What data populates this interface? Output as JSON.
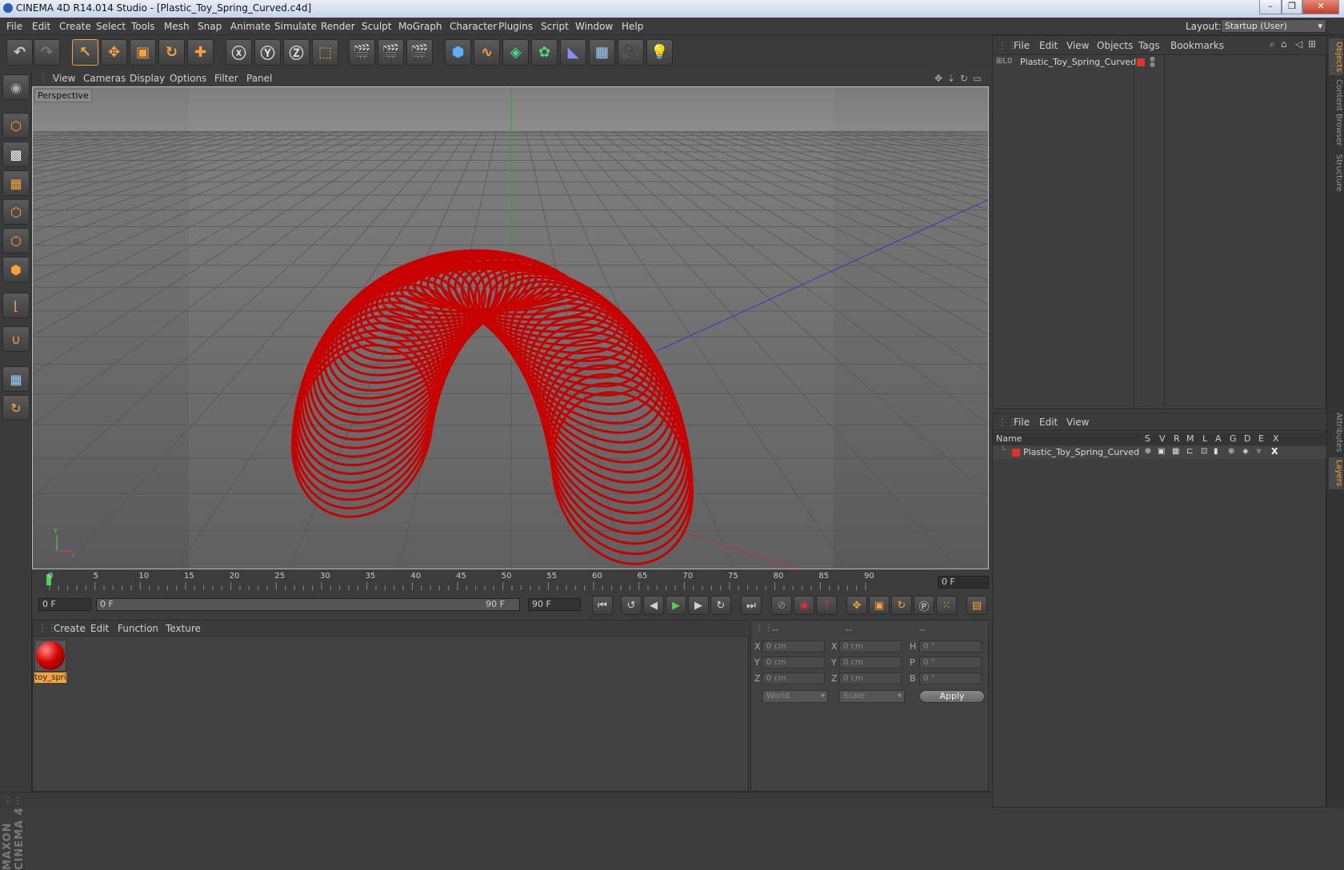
{
  "window": {
    "title": "CINEMA 4D R14.014 Studio - [Plastic_Toy_Spring_Curved.c4d]"
  },
  "menubar": {
    "items": [
      "File",
      "Edit",
      "Create",
      "Select",
      "Tools",
      "Mesh",
      "Snap",
      "Animate",
      "Simulate",
      "Render",
      "Sculpt",
      "MoGraph",
      "Character",
      "Plugins",
      "Script",
      "Window",
      "Help"
    ]
  },
  "layout": {
    "label": "Layout:",
    "value": "Startup (User)"
  },
  "viewport": {
    "menu": [
      "View",
      "Cameras",
      "Display",
      "Options",
      "Filter",
      "Panel"
    ],
    "label": "Perspective"
  },
  "timeline": {
    "ticks": [
      "0",
      "5",
      "10",
      "15",
      "20",
      "25",
      "30",
      "35",
      "40",
      "45",
      "50",
      "55",
      "60",
      "65",
      "70",
      "75",
      "80",
      "85",
      "90"
    ],
    "current_frame": "0 F"
  },
  "playback": {
    "start_field": "0 F",
    "range_start": "0 F",
    "range_end": "90 F",
    "end_field": "90 F"
  },
  "materials": {
    "menu": [
      "Create",
      "Edit",
      "Function",
      "Texture"
    ],
    "item_label": "toy_spri"
  },
  "coords": {
    "header": [
      "--",
      "--",
      "--"
    ],
    "rows": [
      {
        "l1": "X",
        "v1": "0 cm",
        "l2": "X",
        "v2": "0 cm",
        "l3": "H",
        "v3": "0 °"
      },
      {
        "l1": "Y",
        "v1": "0 cm",
        "l2": "Y",
        "v2": "0 cm",
        "l3": "P",
        "v3": "0 °"
      },
      {
        "l1": "Z",
        "v1": "0 cm",
        "l2": "Z",
        "v2": "0 cm",
        "l3": "B",
        "v3": "0 °"
      }
    ],
    "world": "World",
    "scale": "Scale",
    "apply": "Apply"
  },
  "objects": {
    "menu": [
      "File",
      "Edit",
      "View",
      "Objects",
      "Tags",
      "Bookmarks"
    ],
    "item": "Plastic_Toy_Spring_Curved"
  },
  "layers": {
    "menu": [
      "File",
      "Edit",
      "View"
    ],
    "columns": [
      "Name",
      "S",
      "V",
      "R",
      "M",
      "L",
      "A",
      "G",
      "D",
      "E",
      "X"
    ],
    "item": "Plastic_Toy_Spring_Curved"
  },
  "side_tabs": [
    "Objects",
    "Content Browser",
    "Structure",
    "Attributes",
    "Layers"
  ],
  "logo": {
    "line1": "MAXON",
    "line2": "CINEMA 4D"
  },
  "colors": {
    "accent": "#f4a23a",
    "layer_red": "#e23030",
    "spring_red": "#d40000"
  }
}
